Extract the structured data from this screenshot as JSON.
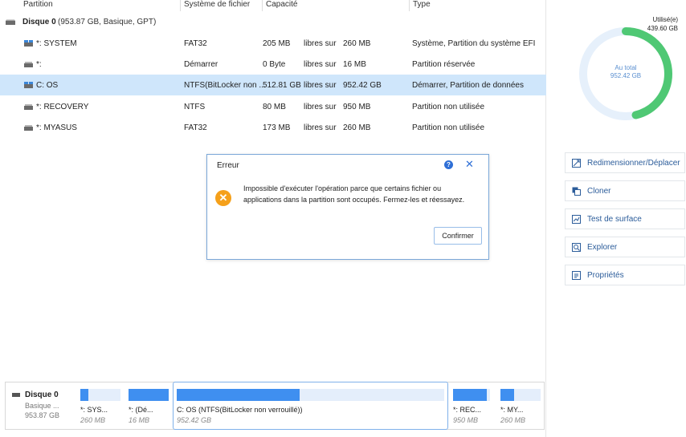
{
  "table": {
    "headers": {
      "partition": "Partition",
      "filesystem": "Système de fichier",
      "capacity": "Capacité",
      "type": "Type"
    },
    "disk": {
      "name": "Disque 0",
      "info": "(953.87 GB, Basique, GPT)"
    },
    "rows": [
      {
        "name": "*: SYSTEM",
        "fs": "FAT32",
        "used": "205 MB",
        "sep": "libres sur",
        "total": "260 MB",
        "type": "Système, Partition du système EFI"
      },
      {
        "name": "*:",
        "fs": "Démarrer",
        "used": "0 Byte",
        "sep": "libres sur",
        "total": "16 MB",
        "type": "Partition réservée"
      },
      {
        "name": "C: OS",
        "fs": "NTFS(BitLocker non ...",
        "used": "512.81 GB",
        "sep": "libres sur",
        "total": "952.42 GB",
        "type": "Démarrer, Partition de données"
      },
      {
        "name": "*: RECOVERY",
        "fs": "NTFS",
        "used": "80 MB",
        "sep": "libres sur",
        "total": "950 MB",
        "type": "Partition non utilisée"
      },
      {
        "name": "*: MYASUS",
        "fs": "FAT32",
        "used": "173 MB",
        "sep": "libres sur",
        "total": "260 MB",
        "type": "Partition non utilisée"
      }
    ]
  },
  "diskmap": {
    "label": "Disque 0",
    "sub1": "Basique ...",
    "sub2": "953.87 GB",
    "segments": [
      {
        "name": "*: SYS...",
        "size": "260 MB",
        "used_pct": 20
      },
      {
        "name": "*: (Dé...",
        "size": "16 MB",
        "used_pct": 100
      },
      {
        "name": "C: OS (NTFS(BitLocker non verrouillé))",
        "size": "952.42 GB",
        "used_pct": 46
      },
      {
        "name": "*: REC...",
        "size": "950 MB",
        "used_pct": 92
      },
      {
        "name": "*: MY...",
        "size": "260 MB",
        "used_pct": 34
      }
    ]
  },
  "summary": {
    "used_label": "Utilisé(e)",
    "used_value": "439.60 GB",
    "total_label": "Au total",
    "total_value": "952.42 GB",
    "used_fraction": 0.4615,
    "colors": {
      "used": "#4fc874",
      "free": "#e6f0fb"
    }
  },
  "actions": [
    {
      "label": "Redimensionner/Déplacer",
      "icon": "resize-icon"
    },
    {
      "label": "Cloner",
      "icon": "clone-icon"
    },
    {
      "label": "Test de surface",
      "icon": "surface-test-icon"
    },
    {
      "label": "Explorer",
      "icon": "explore-icon"
    },
    {
      "label": "Propriétés",
      "icon": "properties-icon"
    }
  ],
  "dialog": {
    "title": "Erreur",
    "message": "Impossible d'exécuter l'opération parce que certains fichier ou applications dans la partition sont occupés. Fermez-les et réessayez.",
    "confirm": "Confirmer"
  }
}
